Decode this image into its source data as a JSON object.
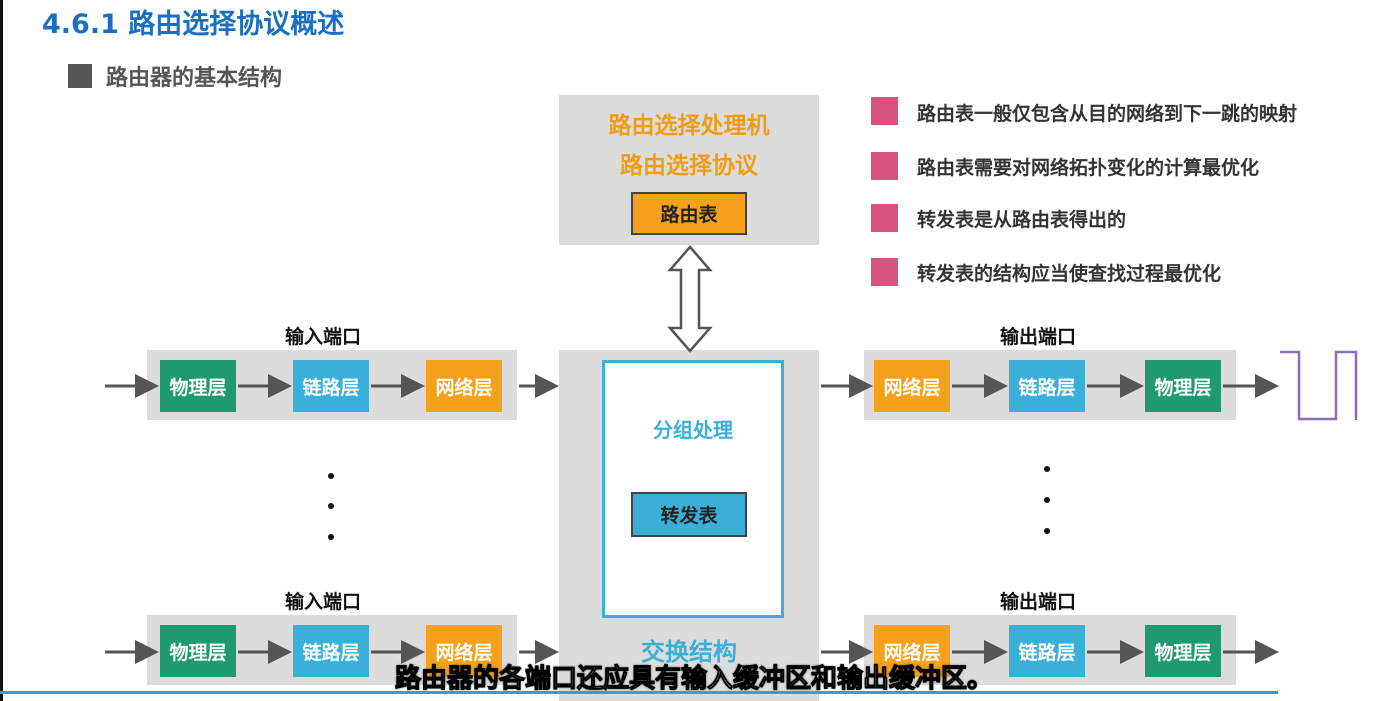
{
  "slide": {
    "title": "4.6.1 路由选择协议概述",
    "section": "路由器的基本结构"
  },
  "routing_processor": {
    "title": "路由选择处理机",
    "protocol": "路由选择协议",
    "table": "路由表"
  },
  "switch_fabric": {
    "packet_processing": "分组处理",
    "forwarding_table": "转发表",
    "label": "交换结构"
  },
  "input_ports": [
    {
      "label": "输入端口",
      "layers": [
        "物理层",
        "链路层",
        "网络层"
      ]
    },
    {
      "label": "输入端口",
      "layers": [
        "物理层",
        "链路层",
        "网络层"
      ]
    }
  ],
  "output_ports": [
    {
      "label": "输出端口",
      "layers": [
        "网络层",
        "链路层",
        "物理层"
      ]
    },
    {
      "label": "输出端口",
      "layers": [
        "网络层",
        "链路层",
        "物理层"
      ]
    }
  ],
  "notes": [
    "路由表一般仅包含从目的网络到下一跳的映射",
    "路由表需要对网络拓扑变化的计算最优化",
    "转发表是从路由表得出的",
    "转发表的结构应当使查找过程最优化"
  ],
  "caption": "路由器的各端口还应具有输入缓冲区和输出缓冲区。",
  "colors": {
    "title": "#1a6fc0",
    "physical": "#1f9a6f",
    "link": "#3ab0d8",
    "network": "#f5a11c",
    "accent_orange": "#f39c12",
    "note_bullet": "#d8527f",
    "signal": "#8a6cc0"
  }
}
